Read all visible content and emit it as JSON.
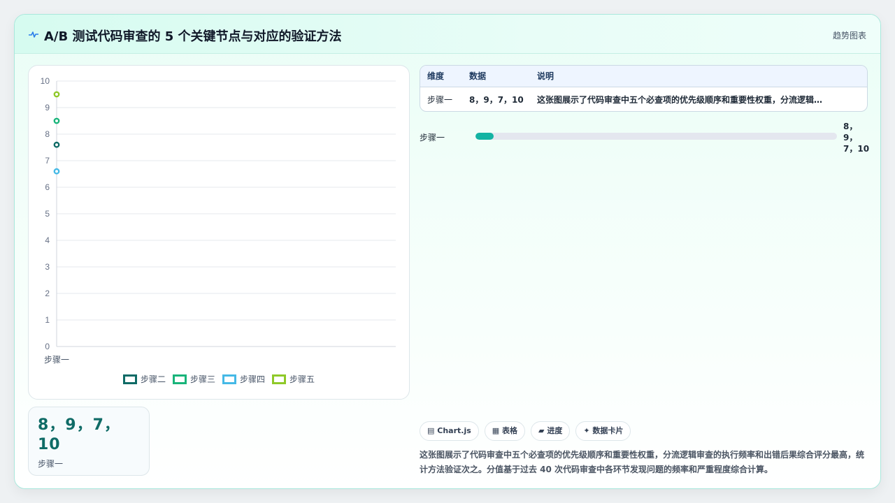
{
  "header": {
    "title": "A/B 测试代码审查的 5 个关键节点与对应的验证方法",
    "icon": "pulse-icon",
    "link_label": "趋势图表"
  },
  "chart_data": {
    "type": "scatter",
    "categories": [
      "步骤一"
    ],
    "series": [
      {
        "name": "步骤二",
        "values": [
          7.6
        ],
        "color": "#0f6b66"
      },
      {
        "name": "步骤三",
        "values": [
          8.5
        ],
        "color": "#19b47a"
      },
      {
        "name": "步骤四",
        "values": [
          6.6
        ],
        "color": "#45b9e6"
      },
      {
        "name": "步骤五",
        "values": [
          9.5
        ],
        "color": "#8fc929"
      }
    ],
    "ylim": [
      0,
      10
    ],
    "yticks": [
      "0",
      "1",
      "2",
      "3",
      "4",
      "5",
      "6",
      "7",
      "8",
      "9",
      "10"
    ],
    "grid": true,
    "legend": "bottom-center"
  },
  "stat": {
    "value": "8，9，7，10",
    "label": "步骤一"
  },
  "table": {
    "headers": [
      "维度",
      "数据",
      "说明"
    ],
    "rows": [
      [
        "步骤一",
        "8，9，7，10",
        "这张图展示了代码审查中五个必查项的优先级顺序和重要性权重，分流逻辑审查的执行频率和出错后果综合评分最高，统计方法验证次之。分值基于过去 40 次代码审查中各环节发现问题的频率和严重程度综合计算。"
      ]
    ]
  },
  "progress": {
    "label": "步骤一",
    "value_text": "8，9，7，10",
    "fraction": 0.05,
    "color": "#13b3a3"
  },
  "chips": [
    {
      "icon": "chart-icon",
      "glyph": "▤",
      "label": "Chart.js"
    },
    {
      "icon": "table-icon",
      "glyph": "▦",
      "label": "表格"
    },
    {
      "icon": "progress-icon",
      "glyph": "▰",
      "label": "进度"
    },
    {
      "icon": "sparkle-icon",
      "glyph": "✦",
      "label": "数据卡片"
    }
  ],
  "note": "这张图展示了代码审查中五个必查项的优先级顺序和重要性权重，分流逻辑审查的执行频率和出错后果综合评分最高，统计方法验证次之。分值基于过去 40 次代码审查中各环节发现问题的频率和严重程度综合计算。"
}
